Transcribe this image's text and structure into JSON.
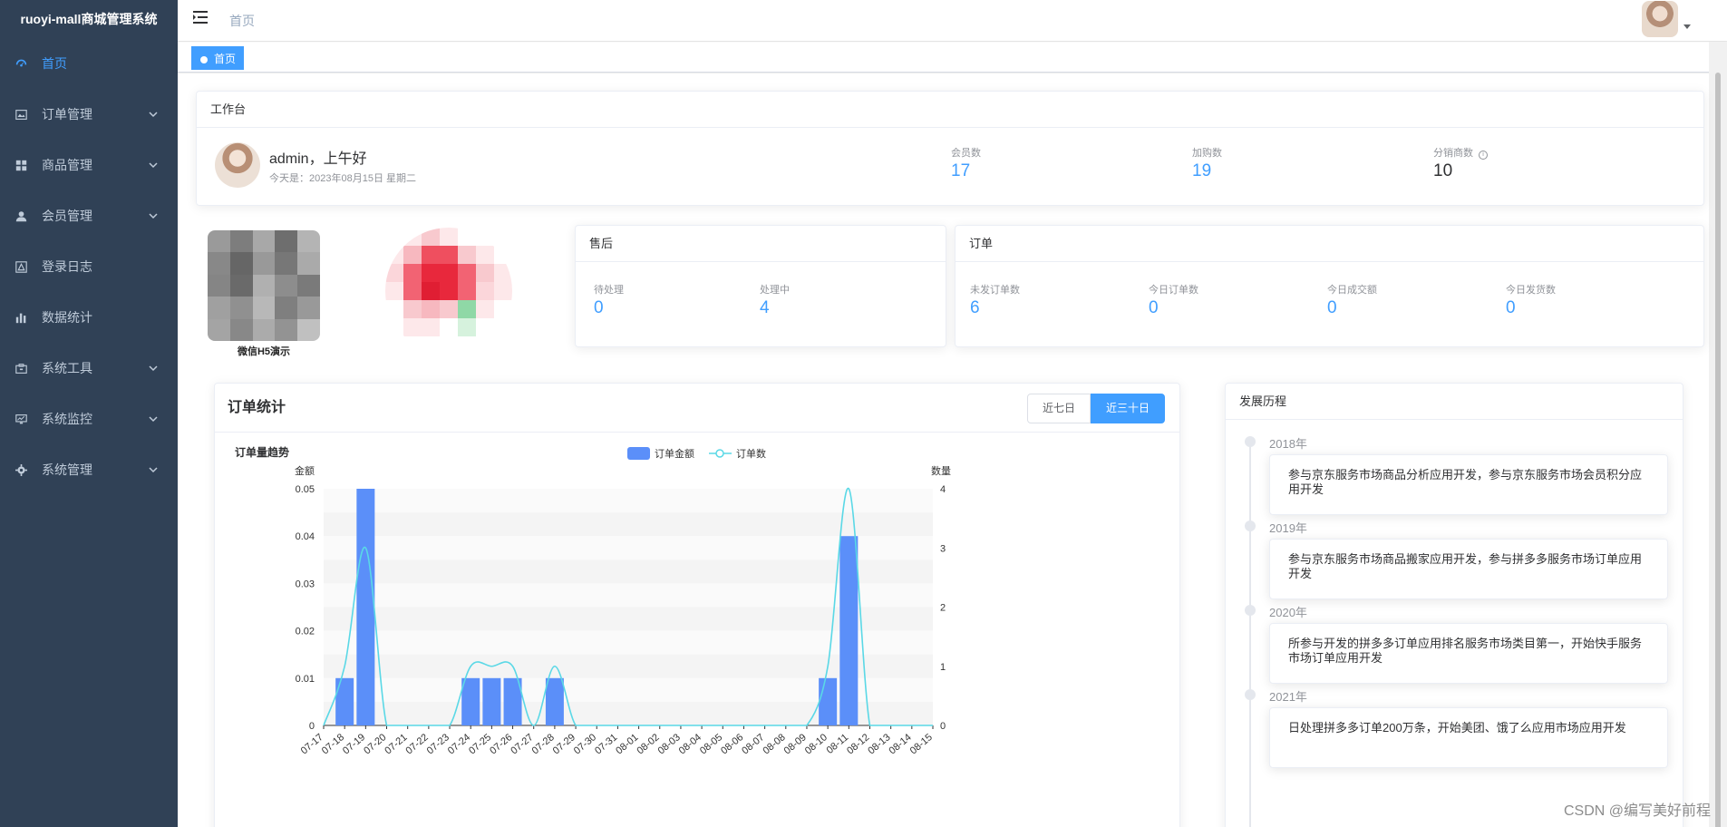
{
  "app": {
    "title": "ruoyi-mall商城管理系统"
  },
  "sidebar": {
    "items": [
      {
        "label": "首页",
        "icon": "dashboard-icon",
        "active": true,
        "has_children": false
      },
      {
        "label": "订单管理",
        "icon": "order-icon",
        "active": false,
        "has_children": true
      },
      {
        "label": "商品管理",
        "icon": "goods-grid-icon",
        "active": false,
        "has_children": true
      },
      {
        "label": "会员管理",
        "icon": "user-icon",
        "active": false,
        "has_children": true
      },
      {
        "label": "登录日志",
        "icon": "login-log-icon",
        "active": false,
        "has_children": false
      },
      {
        "label": "数据统计",
        "icon": "bar-stats-icon",
        "active": false,
        "has_children": false
      },
      {
        "label": "系统工具",
        "icon": "toolbox-icon",
        "active": false,
        "has_children": true
      },
      {
        "label": "系统监控",
        "icon": "monitor-icon",
        "active": false,
        "has_children": true
      },
      {
        "label": "系统管理",
        "icon": "gear-icon",
        "active": false,
        "has_children": true
      }
    ]
  },
  "navbar": {
    "breadcrumb": "首页"
  },
  "tags": [
    {
      "label": "首页",
      "active": true
    }
  ],
  "workbench": {
    "title": "工作台",
    "greeting": "admin，上午好",
    "date_text": "今天是：2023年08月15日 星期二",
    "stats": [
      {
        "label": "会员数",
        "value": "17"
      },
      {
        "label": "加购数",
        "value": "19"
      },
      {
        "label": "分销商数",
        "value": "10"
      }
    ]
  },
  "qr": {
    "label": "微信H5演示"
  },
  "after_sales": {
    "title": "售后",
    "stats": [
      {
        "label": "待处理",
        "value": "0"
      },
      {
        "label": "处理中",
        "value": "4"
      }
    ]
  },
  "orders": {
    "title": "订单",
    "stats": [
      {
        "label": "未发订单数",
        "value": "6"
      },
      {
        "label": "今日订单数",
        "value": "0"
      },
      {
        "label": "今日成交额",
        "value": "0"
      },
      {
        "label": "今日发货数",
        "value": "0"
      }
    ]
  },
  "order_stats": {
    "title": "订单统计",
    "buttons": [
      {
        "label": "近七日",
        "active": false
      },
      {
        "label": "近三十日",
        "active": true
      }
    ]
  },
  "chart_data": {
    "type": "bar",
    "title": "订单量趋势",
    "y_left_label": "金额",
    "y_right_label": "数量",
    "categories": [
      "07-17",
      "07-18",
      "07-19",
      "07-20",
      "07-21",
      "07-22",
      "07-23",
      "07-24",
      "07-25",
      "07-26",
      "07-27",
      "07-28",
      "07-29",
      "07-30",
      "07-31",
      "08-01",
      "08-02",
      "08-03",
      "08-04",
      "08-05",
      "08-06",
      "08-07",
      "08-08",
      "08-09",
      "08-10",
      "08-11",
      "08-12",
      "08-13",
      "08-14",
      "08-15"
    ],
    "y_left_ticks": [
      "0",
      "0.01",
      "0.02",
      "0.03",
      "0.04",
      "0.05"
    ],
    "y_right_ticks": [
      "0",
      "1",
      "2",
      "3",
      "4"
    ],
    "ylim_left": [
      0,
      0.05
    ],
    "ylim_right": [
      0,
      4
    ],
    "series": [
      {
        "name": "订单金额",
        "type": "bar",
        "axis": "left",
        "color": "#5b8ff9",
        "values": [
          0,
          0.01,
          0.05,
          0,
          0,
          0,
          0,
          0.01,
          0.01,
          0.01,
          0,
          0.01,
          0,
          0,
          0,
          0,
          0,
          0,
          0,
          0,
          0,
          0,
          0,
          0,
          0.01,
          0.04,
          0,
          0,
          0,
          0
        ]
      },
      {
        "name": "订单数",
        "type": "line",
        "axis": "right",
        "color": "#5ad8e6",
        "values": [
          0,
          1,
          3,
          0,
          0,
          0,
          0,
          1,
          1,
          1,
          0,
          1,
          0,
          0,
          0,
          0,
          0,
          0,
          0,
          0,
          0,
          0,
          0,
          0,
          1,
          4,
          0,
          0,
          0,
          0
        ]
      }
    ],
    "legend_position": "top-center",
    "grid": true
  },
  "history": {
    "title": "发展历程",
    "items": [
      {
        "year": "2018年",
        "text": "参与京东服务市场商品分析应用开发，参与京东服务市场会员积分应用开发"
      },
      {
        "year": "2019年",
        "text": "参与京东服务市场商品搬家应用开发，参与拼多多服务市场订单应用开发"
      },
      {
        "year": "2020年",
        "text": "所参与开发的拼多多订单应用排名服务市场类目第一，开始快手服务市场订单应用开发"
      },
      {
        "year": "2021年",
        "text": "日处理拼多多订单200万条，开始美团、饿了么应用市场应用开发"
      }
    ]
  },
  "watermark": "CSDN @编写美好前程",
  "colors": {
    "sidebar_bg": "#304156",
    "accent": "#409eff",
    "bar": "#5b8ff9",
    "line": "#5ad8e6"
  }
}
